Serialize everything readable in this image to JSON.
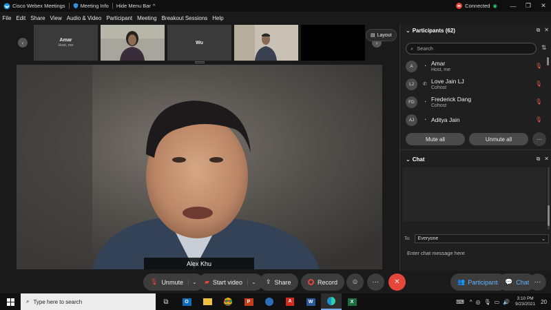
{
  "titlebar": {
    "app_title": "Cisco Webex Meetings",
    "meeting_info": "Meeting Info",
    "hide_menu": "Hide Menu Bar",
    "hide_menu_chevron": "^",
    "status": "Connected",
    "status_color": "#e5473a"
  },
  "menu": [
    "File",
    "Edit",
    "Share",
    "View",
    "Audio & Video",
    "Participant",
    "Meeting",
    "Breakout Sessions",
    "Help"
  ],
  "thumbnails": [
    {
      "name": "Amar",
      "sub": "Host, me",
      "type": "avatar"
    },
    {
      "name": "",
      "sub": "",
      "type": "video"
    },
    {
      "name": "Wu",
      "sub": "",
      "type": "avatar"
    },
    {
      "name": "",
      "sub": "",
      "type": "video"
    },
    {
      "name": "",
      "sub": "",
      "type": "black"
    }
  ],
  "layout_label": "Layout",
  "main_video": {
    "speaker_name": "Alex Khu"
  },
  "controls": {
    "unmute": "Unmute",
    "start_video": "Start video",
    "share": "Share",
    "record": "Record",
    "participants": "Participants",
    "chat": "Chat",
    "end_color": "#e5473a",
    "record_color": "#e5473a",
    "mute_color": "#e5473a"
  },
  "participants_panel": {
    "title": "Participants (62)",
    "search_placeholder": "Search",
    "items": [
      {
        "initials": "A",
        "name": "Amar",
        "role": "Host, me"
      },
      {
        "initials": "LJ",
        "name": "Love Jain LJ",
        "role": "Cohost"
      },
      {
        "initials": "FD",
        "name": "Frederick Dang",
        "role": "Cohost"
      },
      {
        "initials": "AJ",
        "name": "Aditya Jain",
        "role": ""
      }
    ],
    "mute_all": "Mute all",
    "unmute_all": "Unmute all"
  },
  "chat_panel": {
    "title": "Chat",
    "to_label": "To:",
    "to_value": "Everyone",
    "input_placeholder": "Enter chat message here"
  },
  "taskbar": {
    "search_placeholder": "Type here to search",
    "time": "3:10 PM",
    "date": "9/23/2021",
    "notifications": "20"
  }
}
